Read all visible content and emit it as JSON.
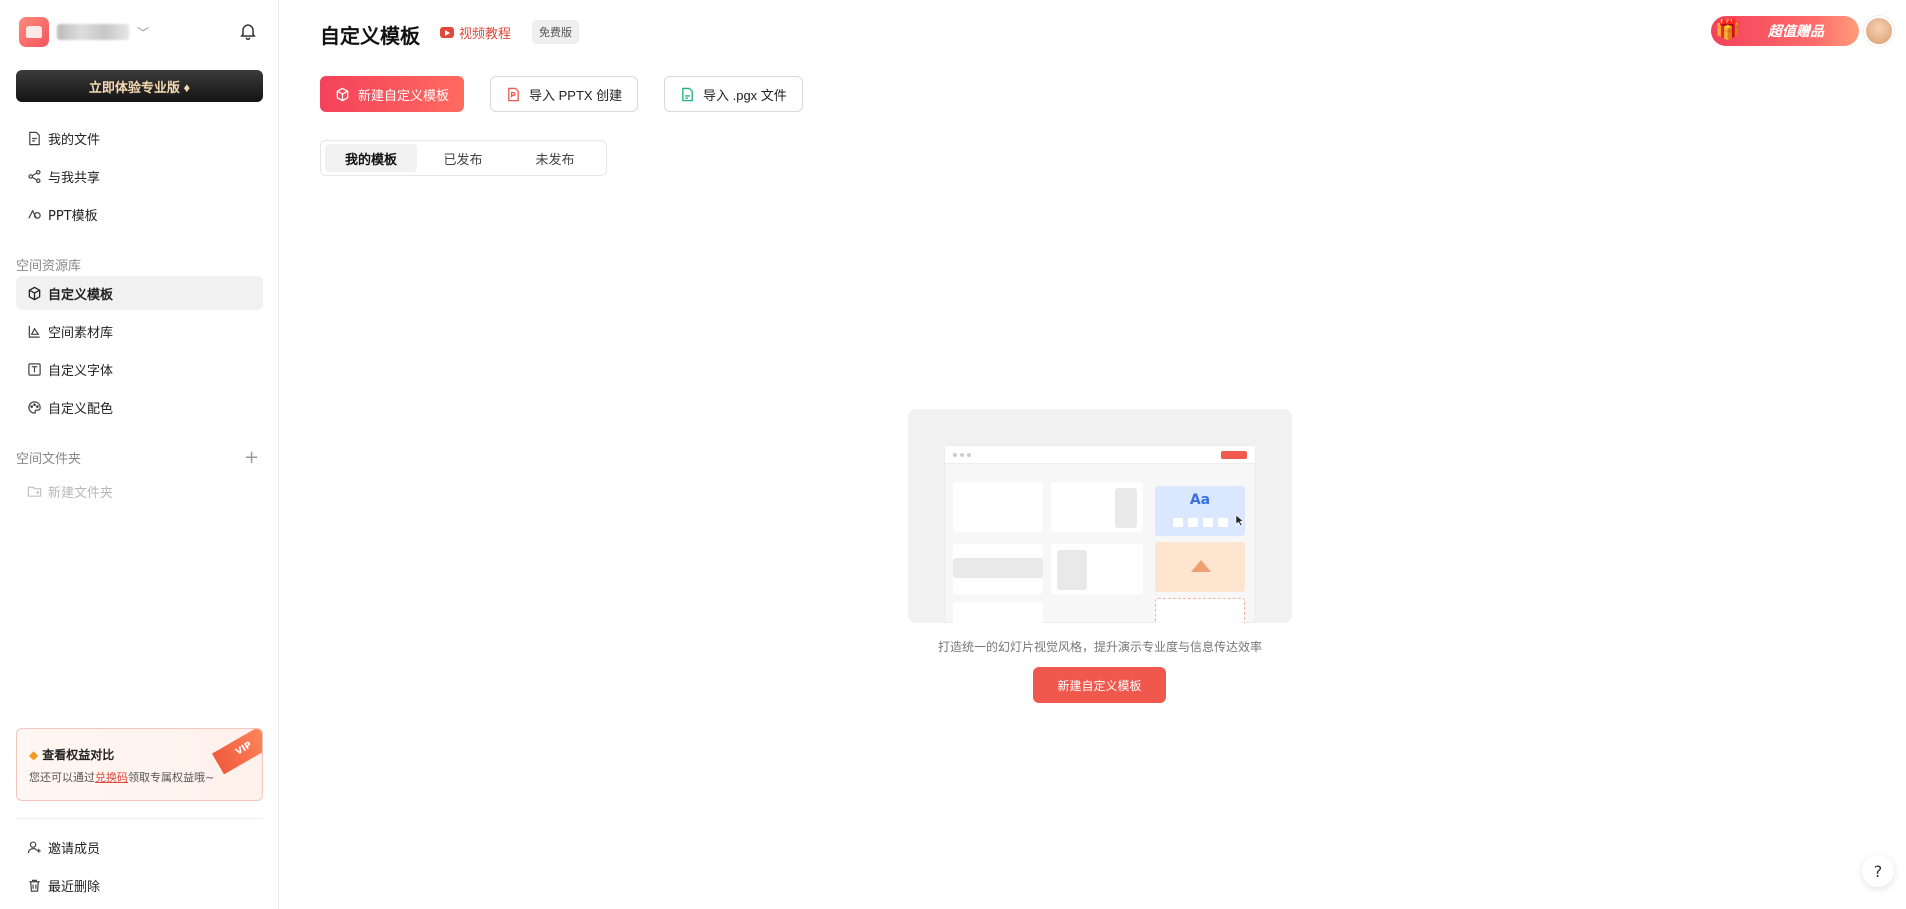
{
  "sidebar": {
    "upgrade_label": "立即体验专业版 ♦",
    "nav": [
      {
        "label": "我的文件",
        "icon": "file-icon"
      },
      {
        "label": "与我共享",
        "icon": "share-icon"
      },
      {
        "label": "PPT模板",
        "icon": "template-icon"
      }
    ],
    "space_library_label": "空间资源库",
    "library": [
      {
        "label": "自定义模板",
        "icon": "cube-icon",
        "active": true
      },
      {
        "label": "空间素材库",
        "icon": "assets-icon"
      },
      {
        "label": "自定义字体",
        "icon": "font-icon"
      },
      {
        "label": "自定义配色",
        "icon": "palette-icon"
      }
    ],
    "space_folder_label": "空间文件夹",
    "new_folder_label": "新建文件夹",
    "promo": {
      "title": "查看权益对比",
      "sub_prefix": "您还可以通过",
      "sub_link": "兑换码",
      "sub_suffix": "领取专属权益哦~",
      "ribbon": "VIP"
    },
    "bottom": [
      {
        "label": "邀请成员",
        "icon": "add-user-icon"
      },
      {
        "label": "最近删除",
        "icon": "trash-icon"
      }
    ]
  },
  "header": {
    "title": "自定义模板",
    "video_label": "视频教程",
    "badge": "免费版",
    "gift_label": "超值赠品"
  },
  "actions": {
    "new_template": "新建自定义模板",
    "import_pptx": "导入 PPTX 创建",
    "import_pgx": "导入 .pgx 文件"
  },
  "tabs": [
    "我的模板",
    "已发布",
    "未发布"
  ],
  "empty": {
    "illus_aa": "Aa",
    "description": "打造统一的幻灯片视觉风格，提升演示专业度与信息传达效率",
    "button": "新建自定义模板"
  },
  "help_label": "?",
  "colors": {
    "accent": "#f0574d",
    "primary_gradient_start": "#f3425b"
  }
}
